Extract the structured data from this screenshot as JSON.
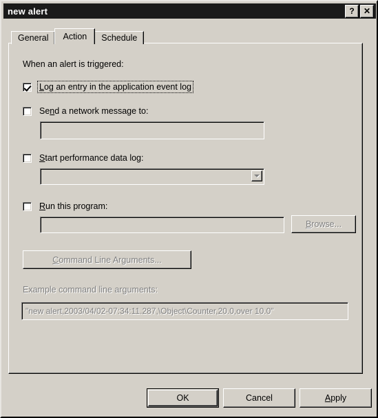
{
  "window": {
    "title": "new alert",
    "help_button": "?",
    "close_button": "✕"
  },
  "tabs": [
    {
      "label": "General",
      "selected": false
    },
    {
      "label": "Action",
      "selected": true
    },
    {
      "label": "Schedule",
      "selected": false
    }
  ],
  "action_tab": {
    "intro_label": "When an alert is triggered:",
    "log_entry": {
      "label_before": "",
      "accel": "L",
      "label_after": "og an entry in the application event log",
      "checked": true,
      "focused": true
    },
    "network_message": {
      "label_before": "Se",
      "accel": "n",
      "label_after": "d a network message to:",
      "checked": false,
      "input_value": "",
      "input_enabled": false
    },
    "performance_log": {
      "label_before": "",
      "accel": "S",
      "label_after": "tart performance data log:",
      "checked": false,
      "combo_value": "",
      "combo_enabled": false
    },
    "run_program": {
      "label_before": "",
      "accel": "R",
      "label_after": "un this program:",
      "checked": false,
      "input_value": "",
      "input_enabled": false
    },
    "browse_button": {
      "label_before": "",
      "accel": "B",
      "label_after": "rowse...",
      "enabled": false
    },
    "command_line_args_button": {
      "label_before": "",
      "accel": "C",
      "label_after": "ommand Line Arguments...",
      "enabled": false
    },
    "example_label": "Example command line arguments:",
    "example_value": "\"new alert,2003/04/02-07:34:11.287,\\Object\\Counter,20.0,over 10.0\"",
    "example_enabled": false
  },
  "footer": {
    "ok": {
      "label": "OK",
      "default": true
    },
    "cancel": {
      "label": "Cancel"
    },
    "apply": {
      "label_before": "",
      "accel": "A",
      "label_after": "pply"
    }
  },
  "colors": {
    "dialog_face": "#d4d0c8",
    "titlebar": "#1a1a1a",
    "titlebar_text": "#ffffff",
    "disabled_text": "#808080",
    "text": "#000000"
  }
}
